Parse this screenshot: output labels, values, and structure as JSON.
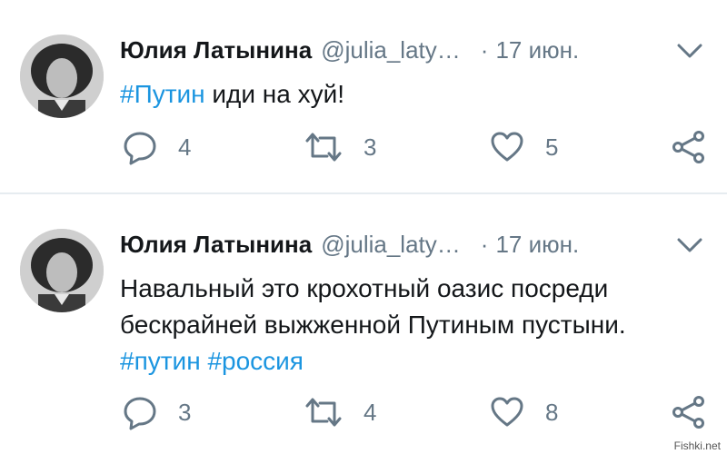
{
  "tweets": [
    {
      "author_name": "Юлия Латынина",
      "handle": "@julia_laty…",
      "separator": "·",
      "date": "17 июн.",
      "text_parts": [
        {
          "text": "#Путин",
          "hashtag": true
        },
        {
          "text": " иди на хуй!",
          "hashtag": false
        }
      ],
      "replies": "4",
      "retweets": "3",
      "likes": "5"
    },
    {
      "author_name": "Юлия Латынина",
      "handle": "@julia_laty…",
      "separator": "·",
      "date": "17 июн.",
      "text_lines": [
        "Навальный это крохотный оазис посреди",
        "бескрайней выжженной Путиным пустыни."
      ],
      "hashtags": [
        "#путин",
        "#россия"
      ],
      "replies": "3",
      "retweets": "4",
      "likes": "8"
    }
  ],
  "watermark": "Fishki.net",
  "colors": {
    "hashtag": "#1b95e0",
    "secondary_text": "#657786",
    "primary_text": "#14171a",
    "divider": "#e6ecf0"
  },
  "icons": [
    "chevron-down-icon",
    "reply-icon",
    "retweet-icon",
    "like-icon",
    "share-icon"
  ]
}
